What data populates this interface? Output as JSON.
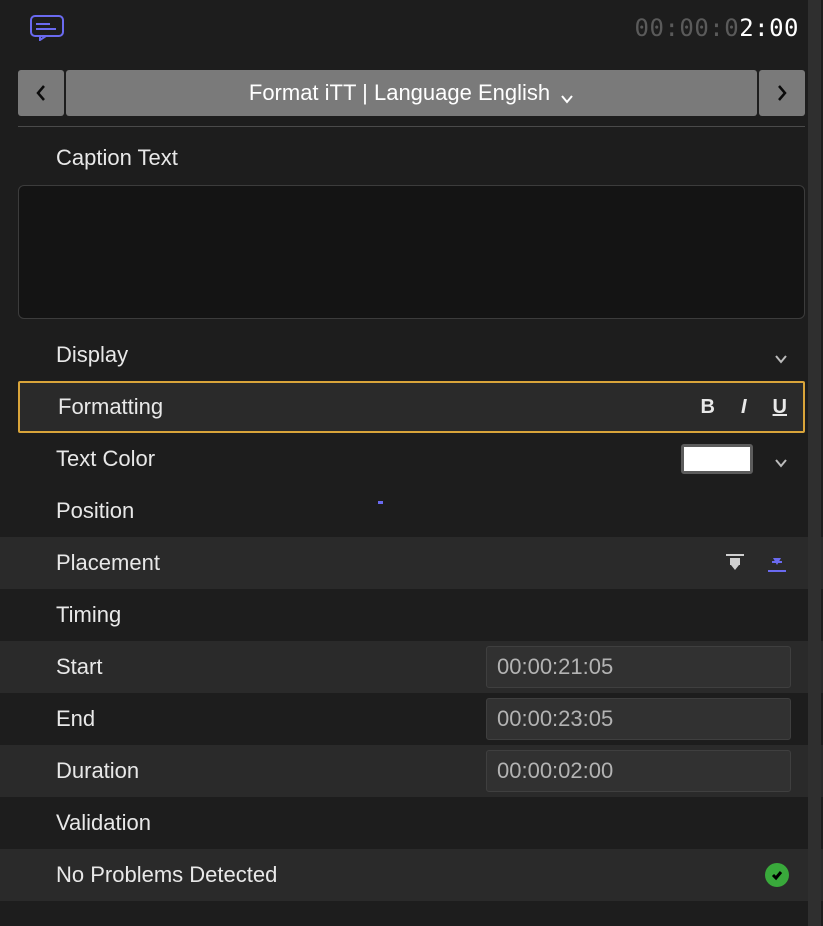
{
  "header": {
    "timecode_dim": "00:00:0",
    "timecode_lit": "2:00",
    "nav_title": "Format iTT | Language English"
  },
  "sections": {
    "caption_text_label": "Caption Text",
    "display_label": "Display",
    "formatting_label": "Formatting",
    "text_color_label": "Text Color",
    "text_color_value": "#FFFFFF",
    "position_label": "Position",
    "placement_label": "Placement",
    "timing_label": "Timing",
    "start_label": "Start",
    "start_value": "00:00:21:05",
    "end_label": "End",
    "end_value": "00:00:23:05",
    "duration_label": "Duration",
    "duration_value": "00:00:02:00",
    "validation_label": "Validation",
    "validation_status": "No Problems Detected"
  },
  "format_buttons": {
    "bold": "B",
    "italic": "I",
    "underline": "U"
  },
  "icons": {
    "caption": "caption-bubble-icon",
    "chevron_left": "chevron-left-icon",
    "chevron_right": "chevron-right-icon",
    "chevron_down": "chevron-down-icon",
    "placement_top": "placement-top-icon",
    "placement_bottom": "placement-bottom-icon",
    "check": "checkmark-icon"
  }
}
